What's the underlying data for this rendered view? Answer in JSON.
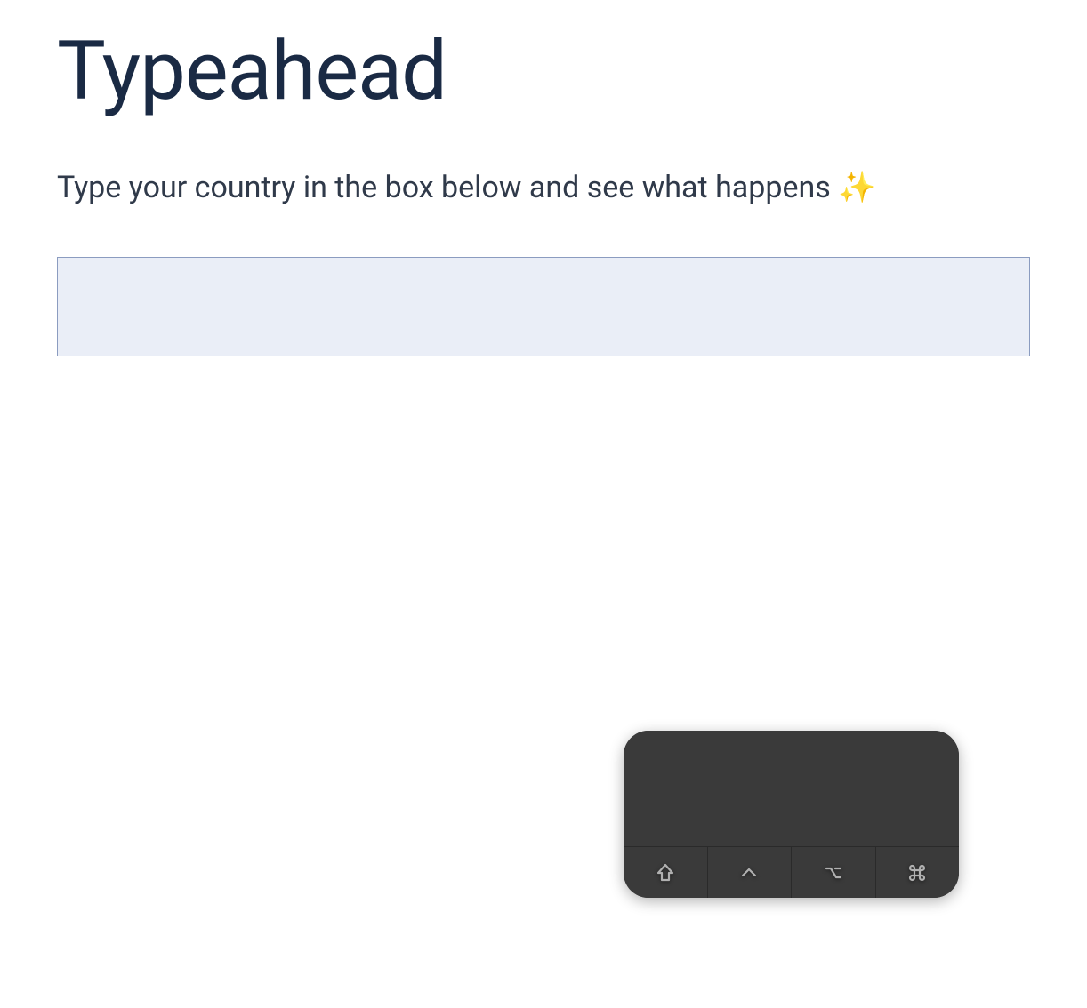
{
  "header": {
    "title": "Typeahead"
  },
  "instruction": {
    "text": "Type your country in the box below and see what happens ",
    "emoji": "✨"
  },
  "input": {
    "value": "",
    "placeholder": ""
  },
  "keycast": {
    "display": "",
    "modifiers": {
      "shift": "⇧",
      "control": "^",
      "option": "⌥",
      "command": "⌘"
    }
  }
}
